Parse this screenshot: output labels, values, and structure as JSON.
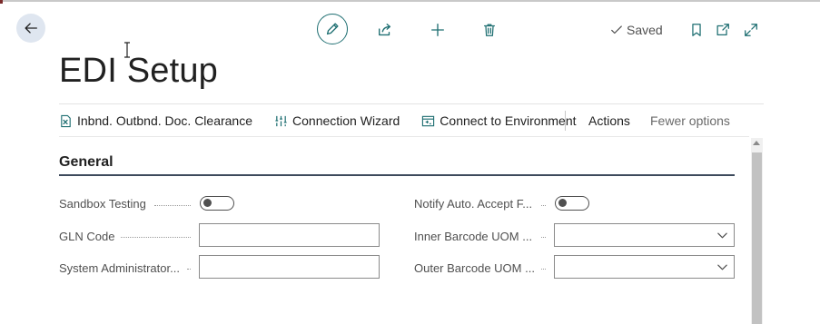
{
  "page": {
    "title": "EDI Setup"
  },
  "header": {
    "saved_label": "Saved"
  },
  "actions": [
    {
      "label": "Inbnd. Outbnd. Doc. Clearance",
      "icon": "doc-clearance-icon"
    },
    {
      "label": "Connection Wizard",
      "icon": "wizard-icon"
    },
    {
      "label": "Connect to Environment",
      "icon": "environment-icon"
    }
  ],
  "menu": {
    "actions_label": "Actions",
    "fewer_options_label": "Fewer options"
  },
  "section": {
    "title": "General",
    "left_fields": [
      {
        "label": "Sandbox Testing",
        "type": "toggle",
        "value": false
      },
      {
        "label": "GLN Code",
        "type": "text",
        "value": ""
      },
      {
        "label": "System Administrator...",
        "type": "text",
        "value": ""
      }
    ],
    "right_fields": [
      {
        "label": "Notify Auto. Accept F...",
        "type": "toggle",
        "value": false
      },
      {
        "label": "Inner Barcode UOM ...",
        "type": "dropdown",
        "value": ""
      },
      {
        "label": "Outer Barcode UOM ...",
        "type": "dropdown",
        "value": ""
      }
    ]
  },
  "colors": {
    "accent": "#1f6f72",
    "section_rule": "#3d4a5c",
    "back_button_bg": "#dfe6f0"
  }
}
